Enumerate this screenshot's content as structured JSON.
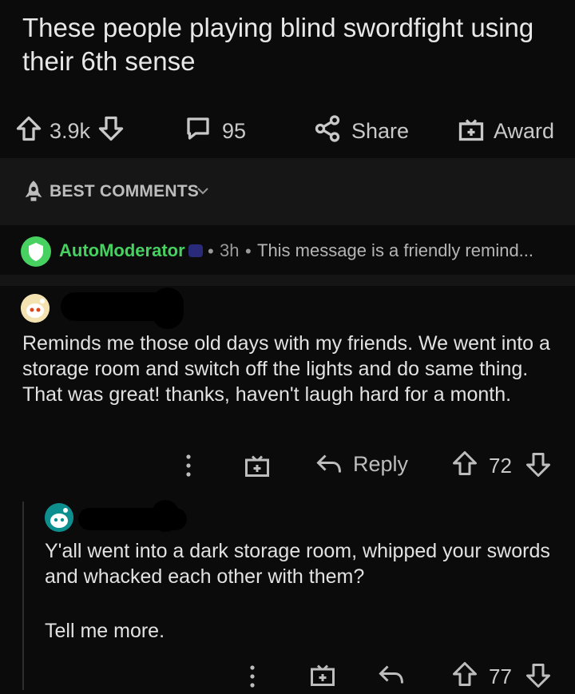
{
  "post": {
    "title": "These people playing blind swordfight using their 6th sense",
    "upvotes": "3.9k",
    "comments": "95",
    "share_label": "Share",
    "award_label": "Award"
  },
  "sort": {
    "label": "BEST COMMENTS"
  },
  "automod": {
    "username": "AutoModerator",
    "time": "3h",
    "preview": "This message is a friendly remind..."
  },
  "comments": [
    {
      "text": "Reminds me those old days with my friends. We went into a storage room and switch off the lights and do same thing. That was great! thanks, haven't laugh hard for a month.",
      "reply_label": "Reply",
      "score": "72"
    },
    {
      "text_line1": "Y'all went into a dark storage room, whipped your swords and whacked each other with them?",
      "text_line2": "Tell me more.",
      "score": "77"
    }
  ],
  "colors": {
    "automod_green": "#46d160",
    "background": "#0b0b0b",
    "text": "#e2e2e2"
  }
}
